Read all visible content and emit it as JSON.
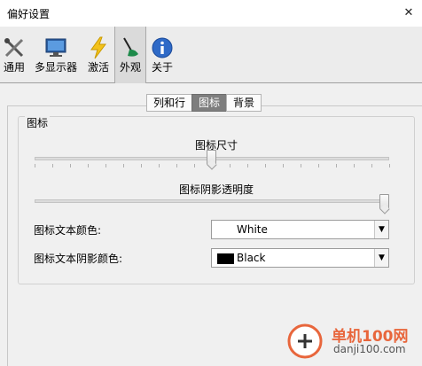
{
  "window": {
    "title": "偏好设置",
    "close_glyph": "✕"
  },
  "toolbar": {
    "items": [
      {
        "label": "通用",
        "icon": "tools-icon"
      },
      {
        "label": "多显示器",
        "icon": "monitor-icon"
      },
      {
        "label": "激活",
        "icon": "lightning-icon"
      },
      {
        "label": "外观",
        "icon": "paintbrush-icon",
        "active": true
      },
      {
        "label": "关于",
        "icon": "info-icon"
      }
    ]
  },
  "tabs": [
    {
      "label": "列和行"
    },
    {
      "label": "图标",
      "active": true
    },
    {
      "label": "背景"
    }
  ],
  "group": {
    "title": "图标",
    "icon_size": {
      "label": "图标尺寸",
      "value_fraction": 0.5
    },
    "shadow_opacity": {
      "label": "图标阴影透明度",
      "value_fraction": 1.0
    },
    "text_color": {
      "label": "图标文本颜色:",
      "value": "White"
    },
    "shadow_color": {
      "label": "图标文本阴影颜色:",
      "value": "Black",
      "swatch": "#000000"
    }
  },
  "watermark": {
    "line1": "单机100网",
    "line2": "danji100.com"
  }
}
